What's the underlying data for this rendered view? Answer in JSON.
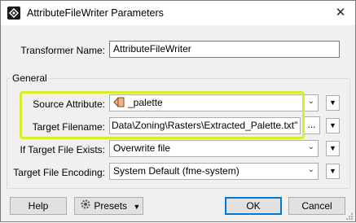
{
  "window": {
    "title": "AttributeFileWriter Parameters",
    "close_glyph": "✕"
  },
  "transformer_name": {
    "label": "Transformer Name:",
    "value": "AttributeFileWriter"
  },
  "general": {
    "title": "General",
    "source_attribute": {
      "label": "Source Attribute:",
      "value": "_palette",
      "icon": "attribute-icon"
    },
    "target_filename": {
      "label": "Target Filename:",
      "value": "Data\\Zoning\\Rasters\\Extracted_Palette.txt\"",
      "browse_label": "..."
    },
    "if_exists": {
      "label": "If Target File Exists:",
      "value": "Overwrite file"
    },
    "encoding": {
      "label": "Target File Encoding:",
      "value": "System Default (fme-system)"
    }
  },
  "buttons": {
    "help": "Help",
    "presets": "Presets",
    "ok": "OK",
    "cancel": "Cancel"
  },
  "colors": {
    "highlight": "#d9ed2d",
    "accent": "#0078d7"
  }
}
